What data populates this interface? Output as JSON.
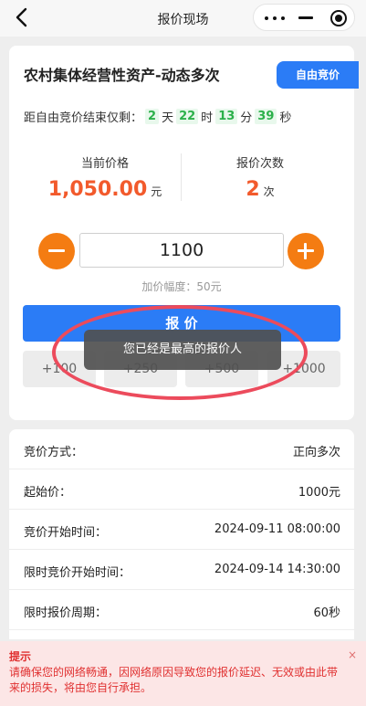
{
  "nav": {
    "title": "报价现场"
  },
  "auction": {
    "title": "农村集体经营性资产-动态多次",
    "mode_button": "自由竞价",
    "countdown": {
      "prefix": "距自由竞价结束仅剩：",
      "days": "2",
      "days_unit": "天",
      "hours": "22",
      "hours_unit": "时",
      "minutes": "13",
      "minutes_unit": "分",
      "seconds": "39",
      "seconds_unit": "秒"
    },
    "current_price": {
      "label": "当前价格",
      "value": "1,050.00",
      "unit": "元"
    },
    "bid_count": {
      "label": "报价次数",
      "value": "2",
      "unit": "次"
    },
    "bid_input_value": "1100",
    "increment_text": "加价幅度：50元",
    "bid_button": "报 价",
    "quick_adds": [
      "+100",
      "+250",
      "+500",
      "+1000"
    ],
    "toast": "您已经是最高的报价人"
  },
  "details": [
    {
      "label": "竞价方式：",
      "value": "正向多次"
    },
    {
      "label": "起始价：",
      "value": "1000元"
    },
    {
      "label": "竞价开始时间：",
      "value": "2024-09-11 08:00:00"
    },
    {
      "label": "限时竞价开始时间：",
      "value": "2024-09-14 14:30:00"
    },
    {
      "label": "限时报价周期：",
      "value": "60秒"
    }
  ],
  "tip": {
    "title": "提示",
    "text": "请确保您的网络畅通，因网络原因导致您的报价延迟、无效或由此带来的损失，将由您自行承担。",
    "close": "×"
  },
  "colors": {
    "accent_blue": "#2b7cf6",
    "orange": "#f47c12",
    "price_red": "#f25a2c",
    "countdown_green": "#2bb04a",
    "annotation": "#ec4b5c"
  }
}
